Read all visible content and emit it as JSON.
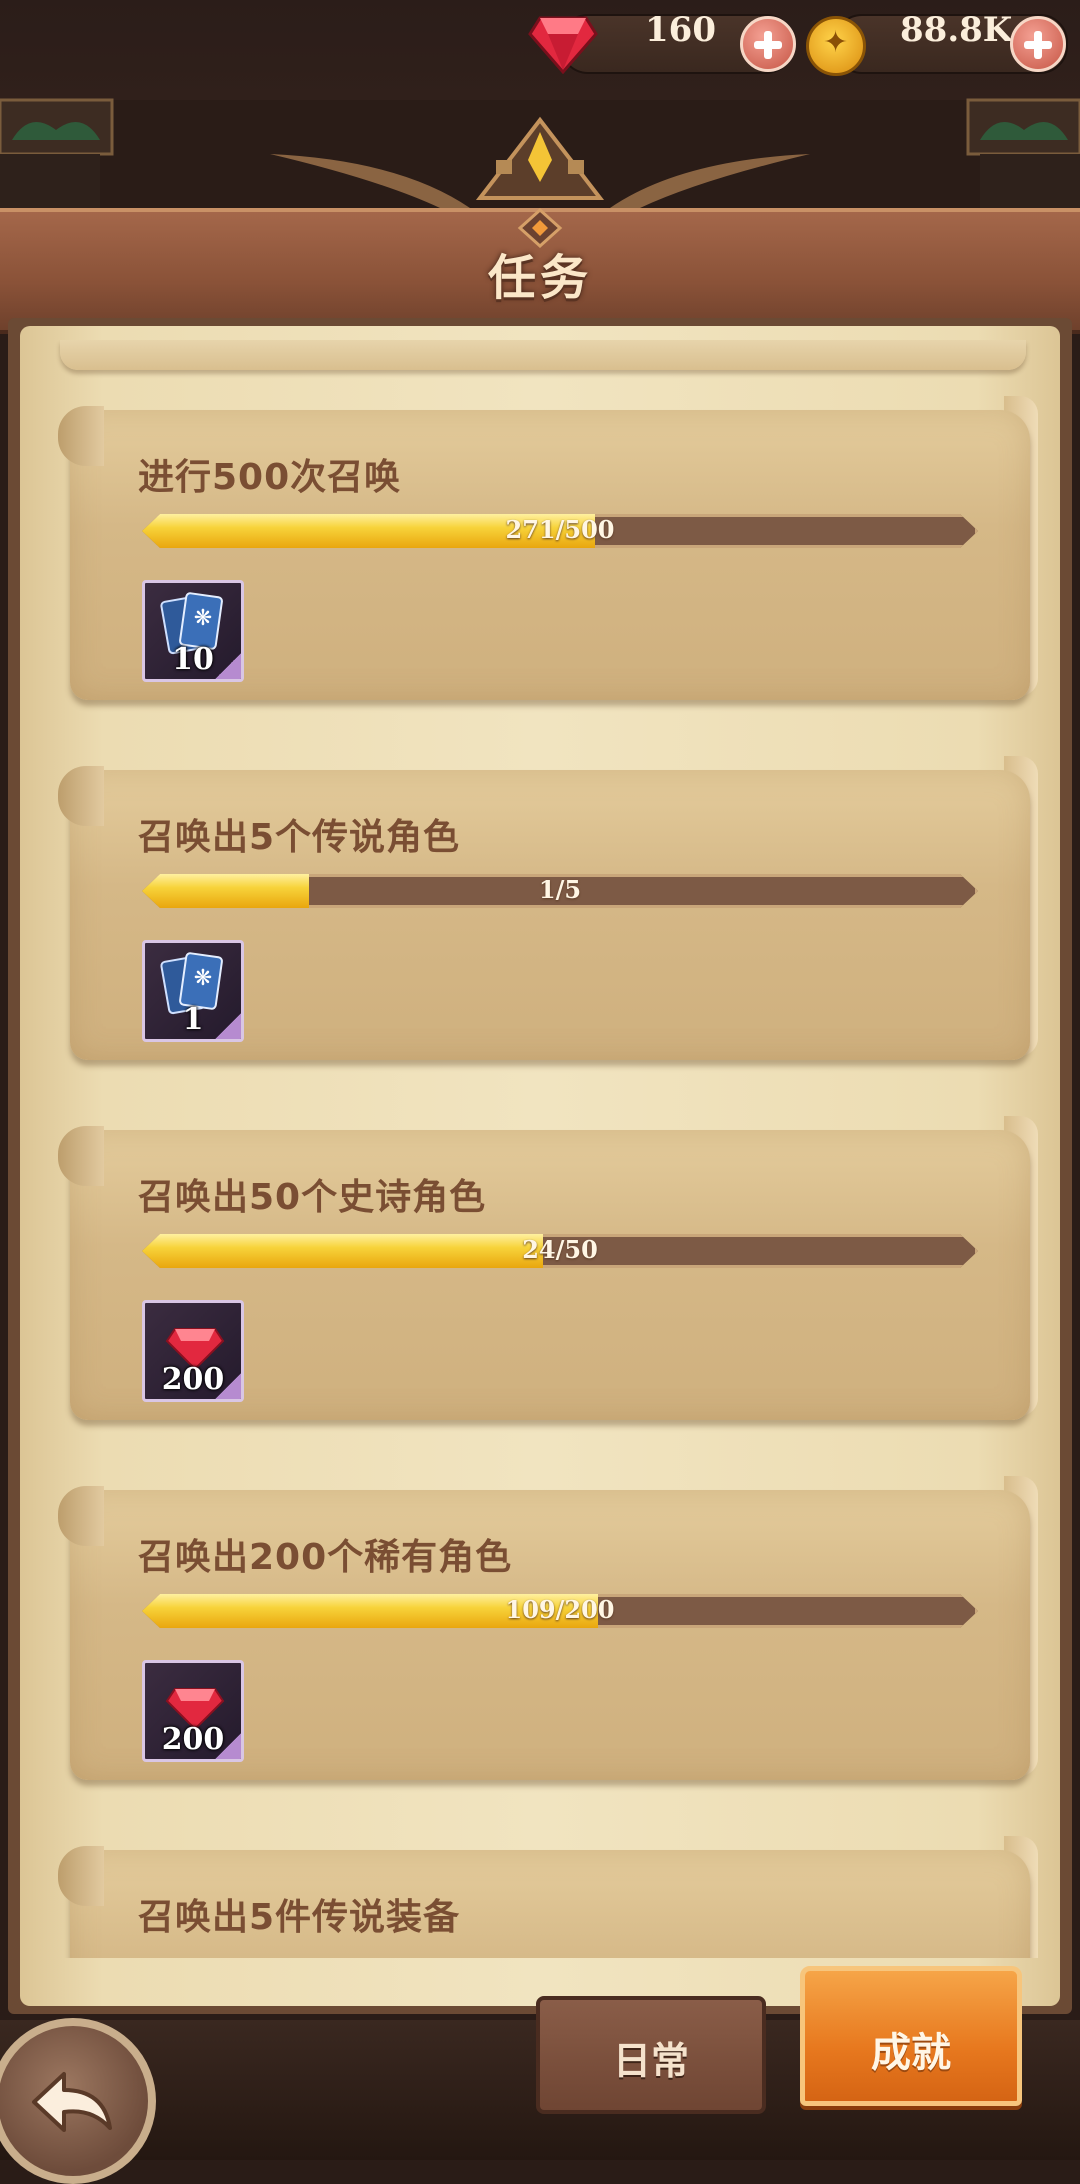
{
  "resources": {
    "gems": "160",
    "gold": "88.8K"
  },
  "header": {
    "title": "任务"
  },
  "quests": [
    {
      "title": "进行500次召唤",
      "progress_text": "271/500",
      "progress": 0.542,
      "reward_type": "summon-card",
      "reward_qty": "10"
    },
    {
      "title": "召唤出5个传说角色",
      "progress_text": "1/5",
      "progress": 0.2,
      "reward_type": "summon-card",
      "reward_qty": "1"
    },
    {
      "title": "召唤出50个史诗角色",
      "progress_text": "24/50",
      "progress": 0.48,
      "reward_type": "gem",
      "reward_qty": "200"
    },
    {
      "title": "召唤出200个稀有角色",
      "progress_text": "109/200",
      "progress": 0.545,
      "reward_type": "gem",
      "reward_qty": "200"
    },
    {
      "title": "召唤出5件传说装备"
    }
  ],
  "tabs": {
    "daily": "日常",
    "achievements": "成就",
    "active": "achievements"
  },
  "colors": {
    "accent_orange": "#e7781e",
    "progress_gold": "#f7d33a",
    "title_brown": "#7a4e33"
  }
}
